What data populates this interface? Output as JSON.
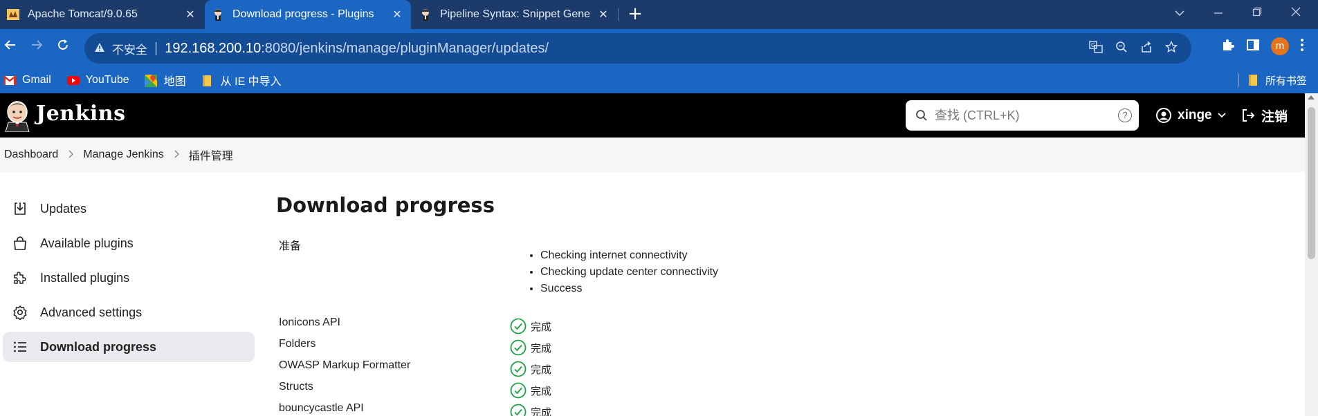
{
  "browser": {
    "tabs": [
      {
        "title": "Apache Tomcat/9.0.65",
        "close": "✕",
        "active": false
      },
      {
        "title": "Download progress - Plugins",
        "close": "✕",
        "active": true
      },
      {
        "title": "Pipeline Syntax: Snippet Gene",
        "close": "✕",
        "active": false
      }
    ],
    "new_tab": "+",
    "address": {
      "security_label": "不安全",
      "separator": "|",
      "host": "192.168.200.10",
      "path": ":8080/jenkins/manage/pluginManager/updates/"
    },
    "profile_initial": "m",
    "bookmarks": [
      {
        "label": "Gmail",
        "icon": "gmail-icon"
      },
      {
        "label": "YouTube",
        "icon": "youtube-icon"
      },
      {
        "label": "地图",
        "icon": "maps-icon"
      },
      {
        "label": "从 IE 中导入",
        "icon": "folder-icon"
      }
    ],
    "all_bookmarks": "所有书签"
  },
  "jenkins": {
    "brand": "Jenkins",
    "search_placeholder": "查找 (CTRL+K)",
    "help": "?",
    "user": "xinge",
    "logout": "注销",
    "breadcrumb": [
      "Dashboard",
      "Manage Jenkins",
      "插件管理"
    ]
  },
  "sidebar": {
    "items": [
      {
        "label": "Updates",
        "icon": "download-icon"
      },
      {
        "label": "Available plugins",
        "icon": "shopping-bag-icon"
      },
      {
        "label": "Installed plugins",
        "icon": "puzzle-icon"
      },
      {
        "label": "Advanced settings",
        "icon": "gear-icon"
      },
      {
        "label": "Download progress",
        "icon": "list-icon"
      }
    ]
  },
  "main": {
    "title": "Download progress",
    "preparation": {
      "label": "准备",
      "steps": [
        "Checking internet connectivity",
        "Checking update center connectivity",
        "Success"
      ]
    },
    "plugins": [
      {
        "name": "Ionicons API",
        "status": "完成"
      },
      {
        "name": "Folders",
        "status": "完成"
      },
      {
        "name": "OWASP Markup Formatter",
        "status": "完成"
      },
      {
        "name": "Structs",
        "status": "完成"
      },
      {
        "name": "bouncycastle API",
        "status": "完成"
      }
    ],
    "status_color": "#1ea446"
  }
}
